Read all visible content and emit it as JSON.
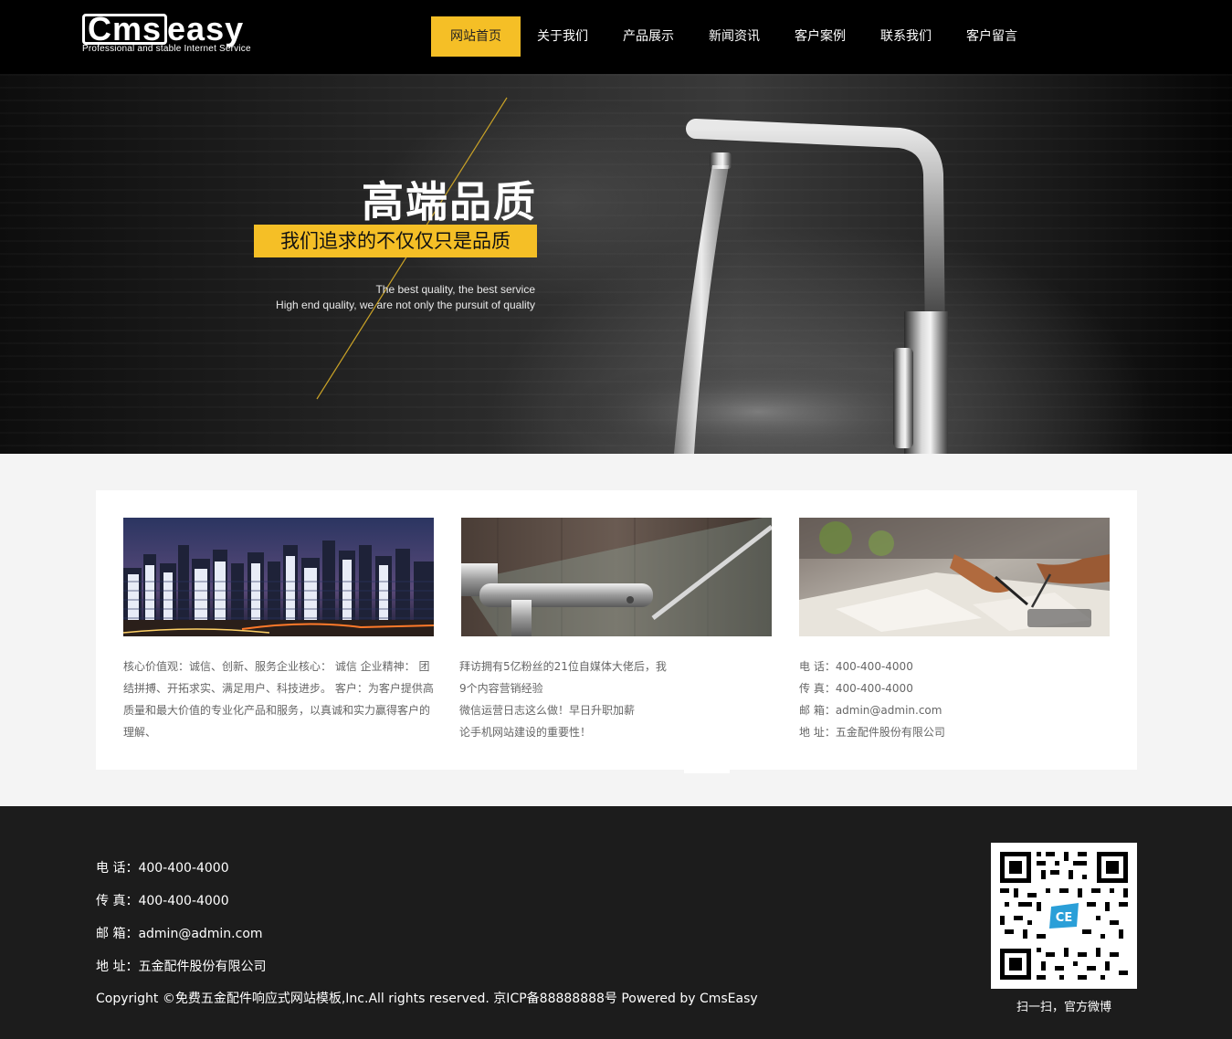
{
  "header": {
    "logo_text_box": "Cms",
    "logo_text_rest": "easy",
    "logo_tagline": "Professional and stable Internet Service",
    "nav": [
      {
        "label": "网站首页",
        "active": true
      },
      {
        "label": "关于我们",
        "active": false
      },
      {
        "label": "产品展示",
        "active": false
      },
      {
        "label": "新闻资讯",
        "active": false
      },
      {
        "label": "客户案例",
        "active": false
      },
      {
        "label": "联系我们",
        "active": false
      },
      {
        "label": "客户留言",
        "active": false
      }
    ]
  },
  "banner": {
    "title": "高端品质",
    "tagline": "我们追求的不仅仅只是品质",
    "en_line1": "The best quality, the best service",
    "en_line2": "High end quality, we are not only the pursuit of quality"
  },
  "cards": [
    {
      "image": "city-night-skyline",
      "lines": [
        "核心价值观：诚信、创新、服务企业核心： 诚信 企业精神： 团",
        "结拼搏、开拓求实、满足用户、科技进步。 客户：为客户提供高",
        "质量和最大价值的专业化产品和服务，以真诚和实力赢得客户的",
        "理解、"
      ]
    },
    {
      "image": "chrome-bathroom-fixture",
      "lines": [
        "拜访拥有5亿粉丝的21位自媒体大佬后，我",
        "9个内容营销经验",
        "微信运营日志这么做！早日升职加薪",
        "论手机网站建设的重要性！"
      ]
    },
    {
      "image": "business-hands-documents",
      "lines": [
        "电 话：400-400-4000",
        "传 真：400-400-4000",
        "邮 箱：admin@admin.com",
        "地 址：五金配件股份有限公司"
      ]
    }
  ],
  "footer": {
    "phone": "电 话：400-400-4000",
    "fax": "传 真：400-400-4000",
    "email": "邮 箱：admin@admin.com",
    "address": "地 址：五金配件股份有限公司",
    "copyright": "Copyright ©免费五金配件响应式网站模板,Inc.All rights reserved.  京ICP备88888888号  Powered by CmsEasy",
    "qr_caption": "扫一扫，官方微博",
    "qr_logo": "CE"
  },
  "colors": {
    "accent": "#f5bf26",
    "header_bg": "#000000",
    "footer_bg": "#1c1c1c",
    "page_bg": "#f4f4f4"
  }
}
